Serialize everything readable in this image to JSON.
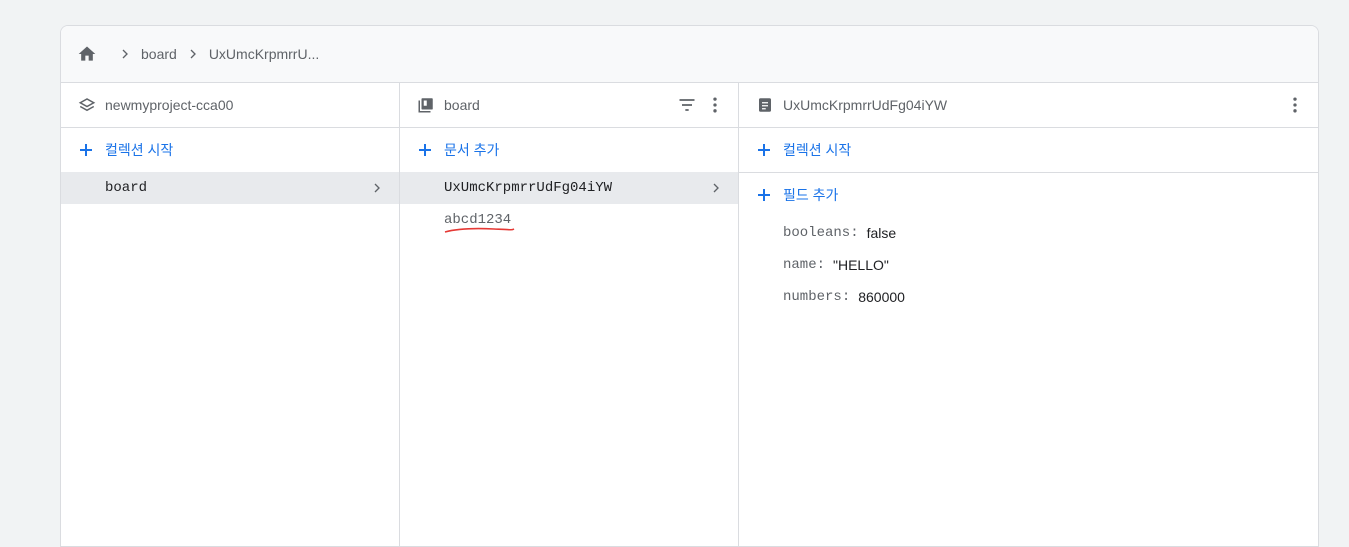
{
  "breadcrumb": {
    "home_icon": "home-icon",
    "items": [
      "board",
      "UxUmcKrpmrrU..."
    ]
  },
  "columns": {
    "project": {
      "title": "newmyproject-cca00",
      "add_label": "컬렉션 시작",
      "items": [
        {
          "label": "board",
          "selected": true
        }
      ]
    },
    "collection": {
      "title": "board",
      "add_label": "문서 추가",
      "items": [
        {
          "label": "UxUmcKrpmrrUdFg04iYW",
          "selected": true
        },
        {
          "label": "abcd1234",
          "selected": false
        }
      ]
    },
    "document": {
      "title": "UxUmcKrpmrrUdFg04iYW",
      "add_collection_label": "컬렉션 시작",
      "add_field_label": "필드 추가",
      "fields": [
        {
          "key": "booleans",
          "value": "false"
        },
        {
          "key": "name",
          "value": "\"HELLO\""
        },
        {
          "key": "numbers",
          "value": "860000"
        }
      ]
    }
  },
  "colors": {
    "accent": "#1a73e8",
    "annotation": "#e53935"
  }
}
